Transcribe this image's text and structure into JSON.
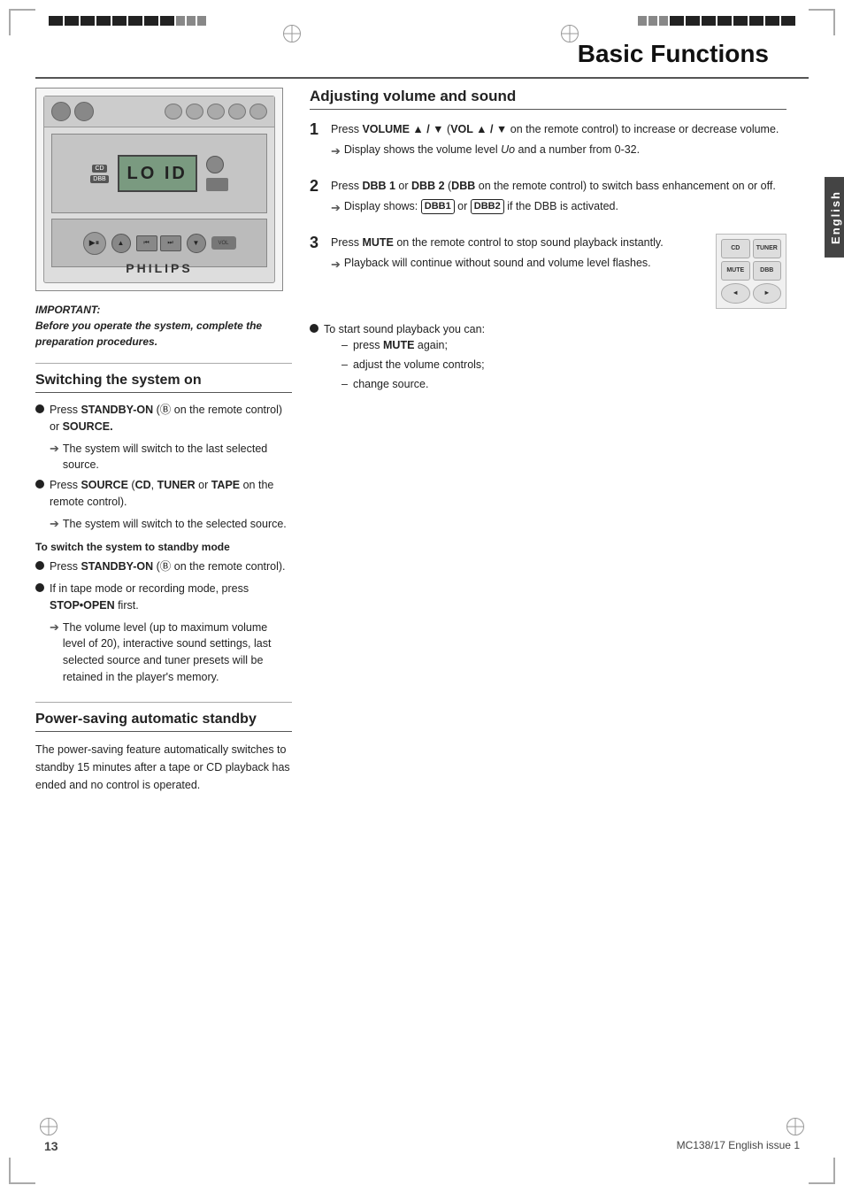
{
  "page": {
    "title": "Basic Functions",
    "page_number": "13",
    "footer_text": "MC138/17 English issue 1",
    "english_tab": "English"
  },
  "device": {
    "brand": "PHILIPS",
    "display_text": "LO ID"
  },
  "important_note": {
    "label": "IMPORTANT:",
    "text": "Before you operate the system, complete the preparation procedures."
  },
  "switching_on": {
    "title": "Switching the system on",
    "bullets": [
      {
        "text_html": "Press <b>STANDBY-ON</b> (&#9399; on the remote control) or <b>SOURCE.</b>",
        "arrow": "The system will switch to the last selected source."
      },
      {
        "text_html": "Press <b>SOURCE</b> (<b>CD</b>, <b>TUNER</b> or <b>TAPE</b> on the remote control).",
        "arrow": "The system will switch to the selected source."
      }
    ],
    "standby_sub_title": "To switch the system to standby mode",
    "standby_bullets": [
      {
        "text_html": "Press <b>STANDBY-ON</b> (&#9399; on the remote control).",
        "arrow": null
      },
      {
        "text_html": "If in tape mode or recording mode, press <b>STOP•OPEN</b> first.",
        "arrow": "The volume level (up to maximum volume level of 20), interactive sound settings, last selected source and tuner presets will be retained in the player's memory."
      }
    ]
  },
  "power_saving": {
    "title": "Power-saving automatic standby",
    "text": "The power-saving feature automatically switches to standby 15 minutes after a tape or CD playback has ended and no control is operated."
  },
  "adjusting_volume": {
    "title": "Adjusting volume and sound",
    "items": [
      {
        "num": "1",
        "text_html": "Press <b>VOLUME ▲ / ▼</b> (<b>VOL ▲ / ▼</b> on the remote control) to increase or decrease volume.",
        "arrow": "Display shows the volume level <i>Uo</i> and a number from 0-32."
      },
      {
        "num": "2",
        "text_html": "Press <b>DBB 1</b> or <b>DBB 2</b> (<b>DBB</b> on the remote control) to switch bass enhancement on or off.",
        "arrow": "Display shows: <span class='badge'>DBB1</span> or <span class='badge'>DBB2</span> if the DBB is activated."
      },
      {
        "num": "3",
        "text_html": "Press <b>MUTE</b> on the remote control to stop sound playback instantly.",
        "arrow": "Playback will continue without sound and volume level flashes.",
        "has_remote": true
      }
    ],
    "sound_restart_title": "To start sound playback you can:",
    "sound_restart_items": [
      "press <b>MUTE</b> again;",
      "adjust the volume controls;",
      "change source."
    ]
  },
  "remote_buttons": [
    {
      "label": "CD",
      "label2": "TUNER"
    },
    {
      "label": "MUTE",
      "label2": "DBB"
    },
    {
      "label": "◂◂",
      "label2": "▸▸"
    },
    {
      "label": "◂",
      "label2": "▸"
    }
  ]
}
